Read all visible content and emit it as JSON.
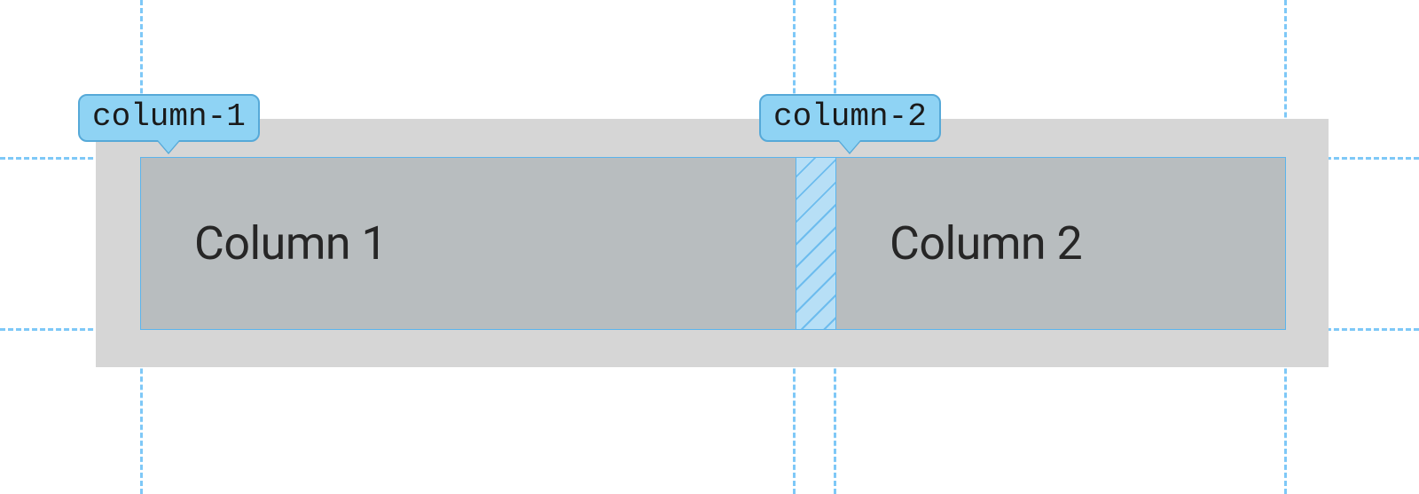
{
  "colors": {
    "guide": "#7ec8f7",
    "container": "#d6d6d6",
    "cell": "#b8bdbf",
    "cell_border": "#5bb4ec",
    "gap_fill": "#b7dff6",
    "tag_bg": "#8fd3f4",
    "tag_border": "#56a9d8",
    "text": "#262626"
  },
  "grid": {
    "tags": {
      "col1": "column-1",
      "col2": "column-2"
    },
    "cells": {
      "col1_label": "Column 1",
      "col2_label": "Column 2"
    }
  }
}
